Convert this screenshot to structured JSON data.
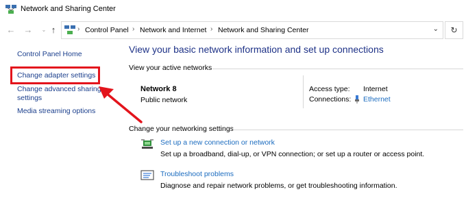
{
  "window": {
    "title": "Network and Sharing Center"
  },
  "navigation": {
    "breadcrumbs": [
      "Control Panel",
      "Network and Internet",
      "Network and Sharing Center"
    ]
  },
  "sidebar": {
    "items": [
      {
        "label": "Control Panel Home"
      },
      {
        "label": "Change adapter settings"
      },
      {
        "label": "Change advanced sharing"
      },
      {
        "label": "settings"
      },
      {
        "label": "Media streaming options"
      }
    ]
  },
  "main": {
    "title": "View your basic network information and set up connections",
    "active_networks_heading": "View your active networks",
    "network": {
      "name": "Network  8",
      "type": "Public network",
      "access_type_label": "Access type:",
      "access_type_value": "Internet",
      "connections_label": "Connections:",
      "connections_value": "Ethernet"
    },
    "settings_heading": "Change your networking settings",
    "tasks": [
      {
        "icon": "new-connection-icon",
        "link": "Set up a new connection or network",
        "description": "Set up a broadband, dial-up, or VPN connection; or set up a router or access point."
      },
      {
        "icon": "troubleshoot-icon",
        "link": "Troubleshoot problems",
        "description": "Diagnose and repair network problems, or get troubleshooting information."
      }
    ]
  },
  "annotation": {
    "highlight_color": "#e3141c"
  }
}
